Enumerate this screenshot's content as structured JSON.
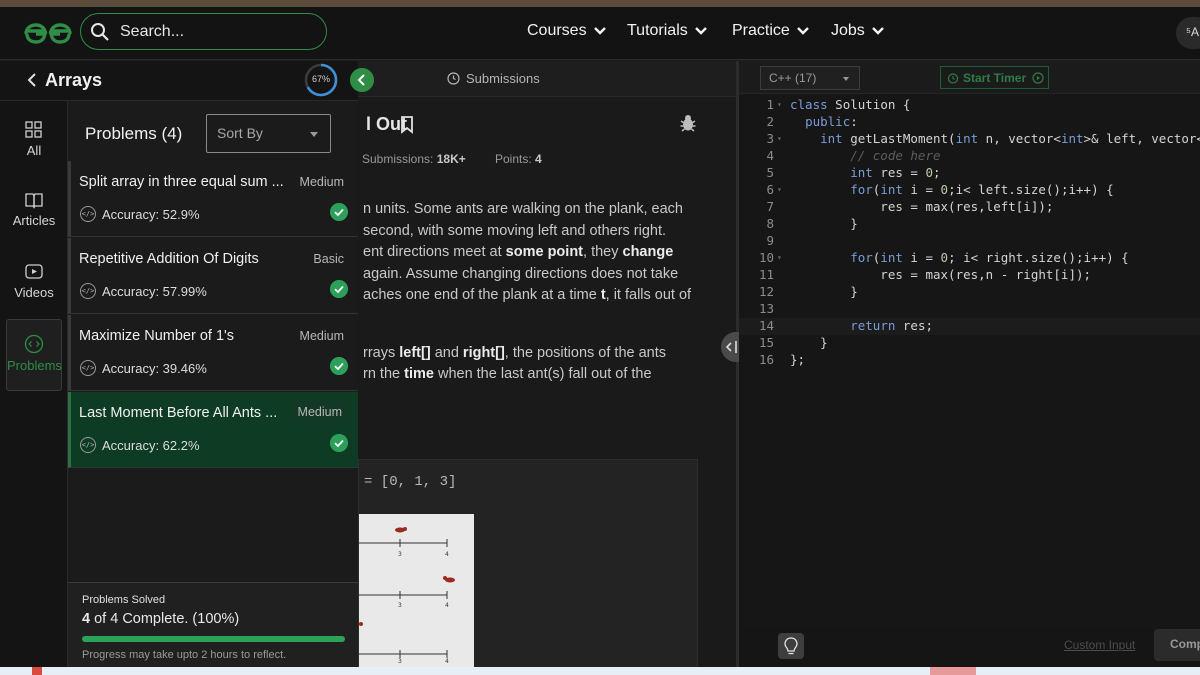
{
  "header": {
    "search_placeholder": "Search...",
    "nav": [
      "Courses",
      "Tutorials",
      "Practice",
      "Jobs"
    ],
    "translate_label": "⁵A"
  },
  "sidebar_rail": {
    "items": [
      {
        "label": "All",
        "icon": "grid-icon"
      },
      {
        "label": "Articles",
        "icon": "book-icon"
      },
      {
        "label": "Videos",
        "icon": "play-icon"
      },
      {
        "label": "Problems",
        "icon": "code-icon",
        "active": true
      }
    ]
  },
  "topic": {
    "title": "Arrays",
    "progress_percent": 67,
    "progress_label": "67%"
  },
  "problem_list": {
    "title": "Problems (4)",
    "sort_placeholder": "Sort By",
    "items": [
      {
        "title": "Split array in three equal sum ...",
        "difficulty": "Medium",
        "accuracy": "Accuracy: 52.9%",
        "solved": true
      },
      {
        "title": "Repetitive Addition Of Digits",
        "difficulty": "Basic",
        "accuracy": "Accuracy: 57.99%",
        "solved": true
      },
      {
        "title": "Maximize Number of 1's",
        "difficulty": "Medium",
        "accuracy": "Accuracy: 39.46%",
        "solved": true
      },
      {
        "title": "Last Moment Before All Ants ...",
        "difficulty": "Medium",
        "accuracy": "Accuracy: 62.2%",
        "solved": true,
        "selected": true
      }
    ],
    "solved_panel": {
      "label": "Problems Solved",
      "count_bold": "4",
      "count_rest": " of 4 Complete. (100%)",
      "progress_fraction": 1.0,
      "note": "Progress may take upto 2 hours to reflect."
    }
  },
  "problem": {
    "submissions_tab": "Submissions",
    "title_fragment": "l Out",
    "submissions_label": "Submissions:",
    "submissions_value": "18K+",
    "points_label": "Points:",
    "points_value": "4",
    "para1_a": "n units. Some ants are walking on the plank, each",
    "para1_b": " second, with some moving left and others right.",
    "para1_c1": "ent directions meet at ",
    "para1_c_bold": "some point",
    "para1_c2": ", they ",
    "para1_c_bold2": "change",
    "para1_d": " again. Assume changing directions does not take",
    "para1_e1": "aches one end of the plank at a time ",
    "para1_e_bold": "t",
    "para1_e2": ", it falls out of",
    "para2_a1": "rrays ",
    "para2_a_bold1": "left[]",
    "para2_a2": " and ",
    "para2_a_bold2": "right[]",
    "para2_a3": ", the positions of the ants",
    "para2_b1": "rn the ",
    "para2_b_bold": "time",
    "para2_b2": " when the last ant(s) fall out of the",
    "example_text": "= [0, 1, 3]"
  },
  "editor": {
    "language": "C++ (17)",
    "timer_label": "Start Timer",
    "lines": [
      {
        "n": "1",
        "fold": true
      },
      {
        "n": "2",
        "fold": false
      },
      {
        "n": "3",
        "fold": true
      },
      {
        "n": "4",
        "fold": false
      },
      {
        "n": "5",
        "fold": false
      },
      {
        "n": "6",
        "fold": true
      },
      {
        "n": "7",
        "fold": false
      },
      {
        "n": "8",
        "fold": false
      },
      {
        "n": "9",
        "fold": false
      },
      {
        "n": "10",
        "fold": true
      },
      {
        "n": "11",
        "fold": false
      },
      {
        "n": "12",
        "fold": false
      },
      {
        "n": "13",
        "fold": false
      },
      {
        "n": "14",
        "fold": false
      },
      {
        "n": "15",
        "fold": false
      },
      {
        "n": "16",
        "fold": false
      }
    ],
    "code": [
      "class Solution {",
      "  public:",
      "    int getLastMoment(int n, vector<int>& left, vector<int>& right) {",
      "        // code here",
      "        int res = 0;",
      "        for(int i = 0;i< left.size();i++) {",
      "            res = max(res,left[i]);",
      "        }",
      "",
      "        for(int i = 0; i< right.size();i++) {",
      "            res = max(res,n - right[i]);",
      "        }",
      "",
      "        return res;",
      "    }",
      "};"
    ],
    "custom_input_label": "Custom Input",
    "compile_label": "Comp"
  },
  "colors": {
    "brand_green": "#2f8d46",
    "selected_row": "#0e3b23",
    "check_green": "#2ca05a"
  }
}
